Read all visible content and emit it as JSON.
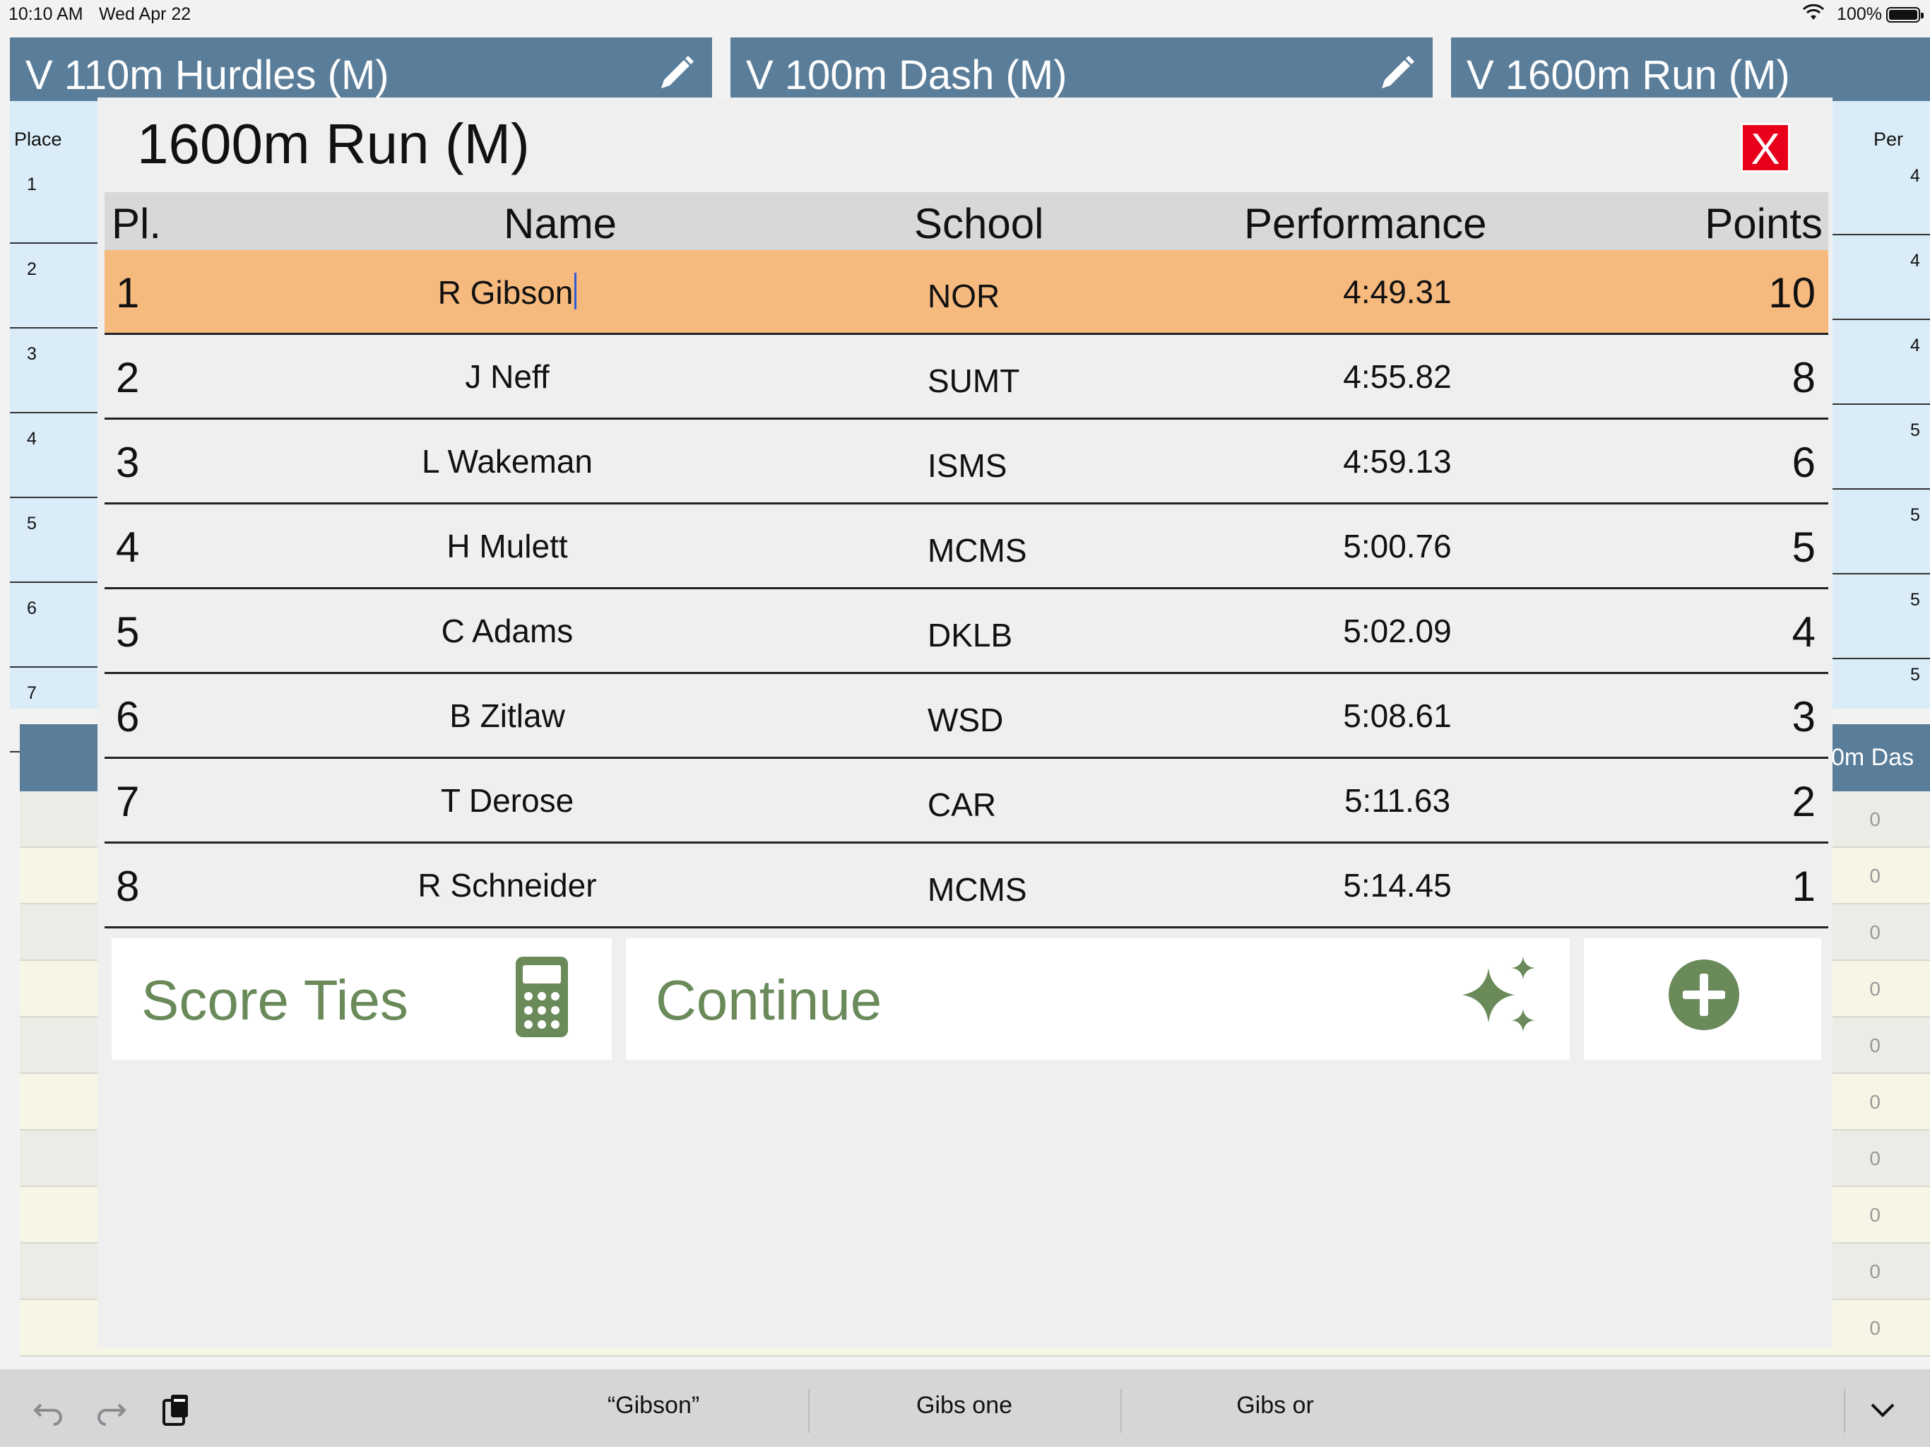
{
  "status": {
    "time": "10:10 AM",
    "date": "Wed Apr 22",
    "battery": "100%"
  },
  "background": {
    "panels": [
      {
        "title": "V 110m Hurdles (M)"
      },
      {
        "title": "V 100m Dash (M)"
      },
      {
        "title": "V 1600m Run (M)"
      }
    ],
    "left_col_header": "Place",
    "left_col_values": [
      "1",
      "2",
      "3",
      "4",
      "5",
      "6",
      "7"
    ],
    "right_col_header": "Per",
    "right_col_values": [
      "4",
      "4",
      "4",
      "5",
      "5",
      "5",
      "5"
    ],
    "lower_header_label": "0m Das",
    "grid_values": [
      "0",
      "0",
      "0",
      "0",
      "0",
      "0",
      "0",
      "0",
      "0",
      "0"
    ]
  },
  "modal": {
    "title": "1600m Run (M)",
    "close_label": "X",
    "columns": {
      "place": "Pl.",
      "name": "Name",
      "school": "School",
      "performance": "Performance",
      "points": "Points"
    },
    "rows": [
      {
        "place": "1",
        "name": "R Gibson",
        "school": "NOR",
        "performance": "4:49.31",
        "points": "10"
      },
      {
        "place": "2",
        "name": "J Neff",
        "school": "SUMT",
        "performance": "4:55.82",
        "points": "8"
      },
      {
        "place": "3",
        "name": "L Wakeman",
        "school": "ISMS",
        "performance": "4:59.13",
        "points": "6"
      },
      {
        "place": "4",
        "name": "H Mulett",
        "school": "MCMS",
        "performance": "5:00.76",
        "points": "5"
      },
      {
        "place": "5",
        "name": "C Adams",
        "school": "DKLB",
        "performance": "5:02.09",
        "points": "4"
      },
      {
        "place": "6",
        "name": "B Zitlaw",
        "school": "WSD",
        "performance": "5:08.61",
        "points": "3"
      },
      {
        "place": "7",
        "name": "T Derose",
        "school": "CAR",
        "performance": "5:11.63",
        "points": "2"
      },
      {
        "place": "8",
        "name": "R Schneider",
        "school": "MCMS",
        "performance": "5:14.45",
        "points": "1"
      }
    ],
    "actions": {
      "score_ties": "Score Ties",
      "continue": "Continue"
    }
  },
  "keyboard_bar": {
    "suggestions": [
      "“Gibson”",
      "Gibs one",
      "Gibs or"
    ]
  },
  "colors": {
    "header_blue": "#5a7d9a",
    "selected_row": "#f6b97e",
    "action_green": "#6a8a5a",
    "close_red": "#e8001a"
  }
}
